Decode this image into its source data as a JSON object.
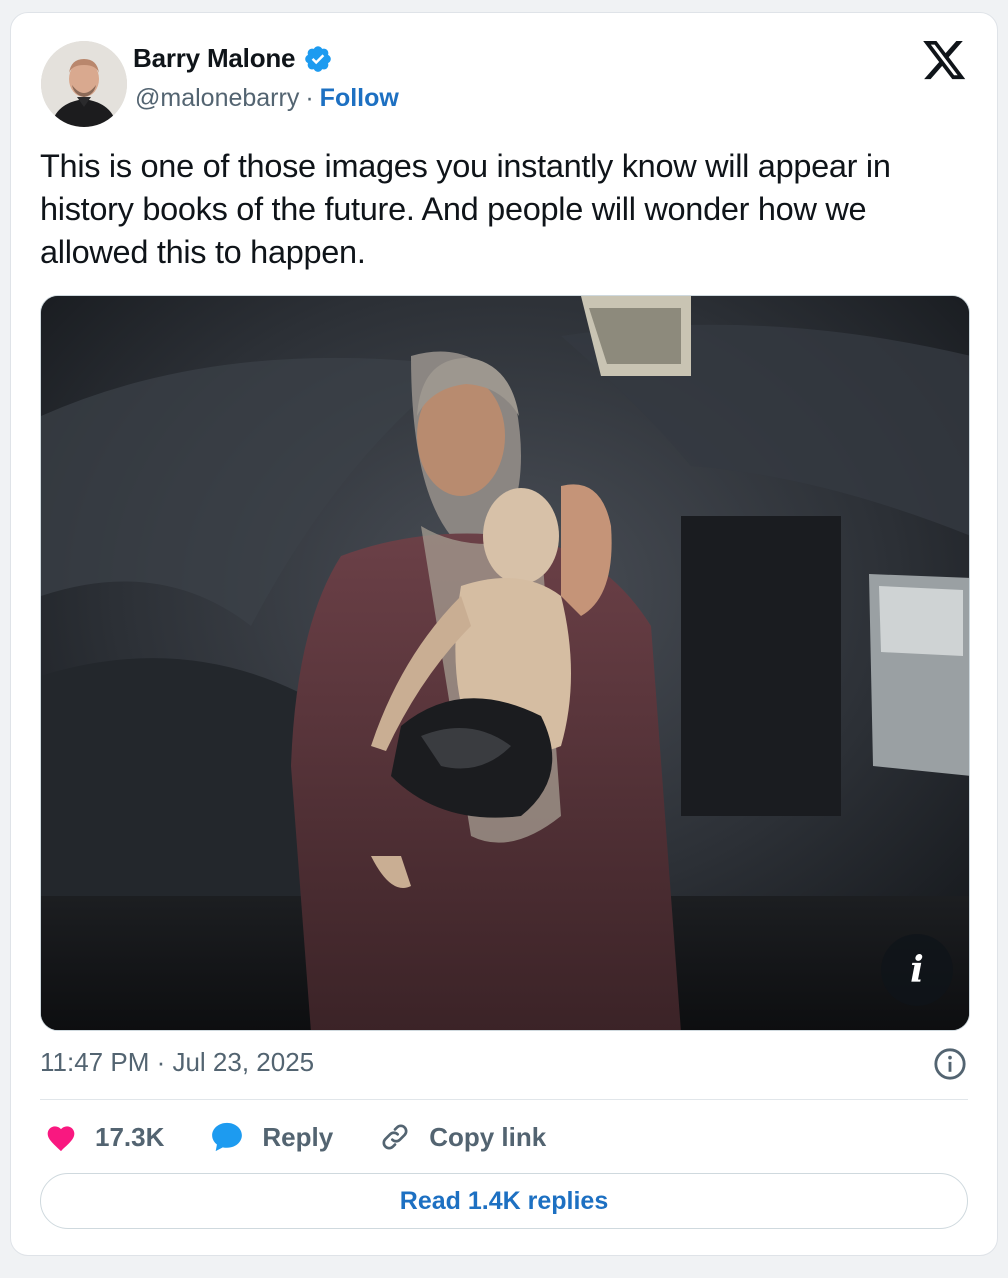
{
  "author": {
    "name": "Barry Malone",
    "handle": "@malonebarry",
    "separator": "·",
    "follow_label": "Follow",
    "verified_color": "#1d9bf0"
  },
  "tweet": {
    "text": "This is one of those images you instantly know will appear in history books of the future. And people will wonder how we allowed this to happen.",
    "timestamp": "11:47 PM · Jul 23, 2025"
  },
  "media": {
    "info_badge": "i"
  },
  "actions": {
    "like_count": "17.3K",
    "reply_label": "Reply",
    "copy_link_label": "Copy link"
  },
  "replies": {
    "read_label": "Read 1.4K replies"
  },
  "colors": {
    "like": "#f91880",
    "reply": "#1d9bf0",
    "link_blue": "#1d70c2",
    "secondary_text": "#536471"
  }
}
